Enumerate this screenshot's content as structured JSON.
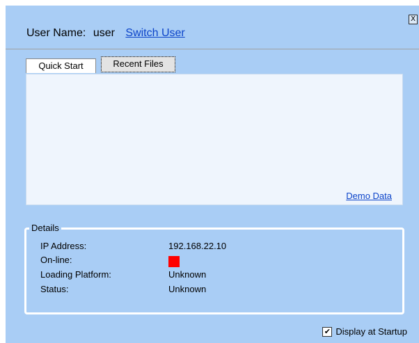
{
  "window": {
    "close_label": "X"
  },
  "header": {
    "user_name_label": "User Name:",
    "user_name": "user",
    "switch_user_label": "Switch User"
  },
  "tabs": [
    {
      "label": "Quick Start"
    },
    {
      "label": "Recent Files"
    }
  ],
  "content": {
    "demo_data_label": "Demo Data"
  },
  "details": {
    "title": "Details",
    "rows": [
      {
        "label": "IP Address:",
        "value": "192.168.22.10"
      },
      {
        "label": "On-line:",
        "value": "",
        "indicator_color": "#ff0000"
      },
      {
        "label": "Loading Platform:",
        "value": "Unknown"
      },
      {
        "label": "Status:",
        "value": "Unknown"
      }
    ]
  },
  "footer": {
    "display_at_startup_label": "Display at Startup",
    "display_at_startup_checked": true,
    "check_glyph": "✔"
  }
}
